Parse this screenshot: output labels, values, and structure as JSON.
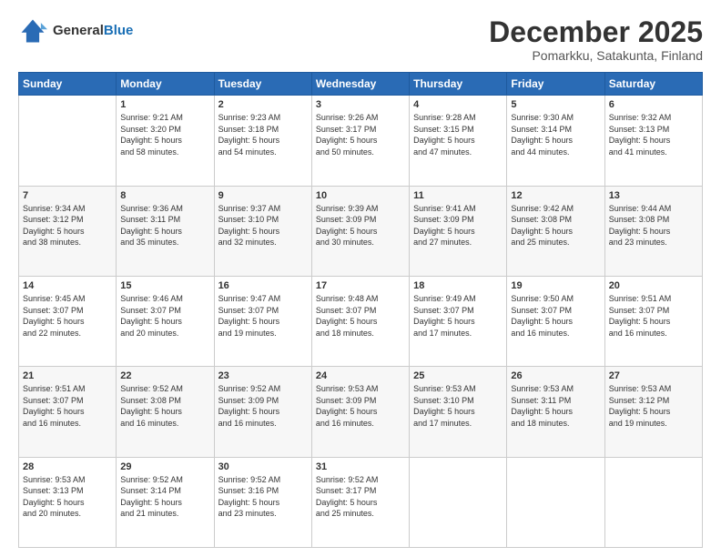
{
  "header": {
    "logo_line1": "General",
    "logo_line2": "Blue",
    "month": "December 2025",
    "location": "Pomarkku, Satakunta, Finland"
  },
  "days_of_week": [
    "Sunday",
    "Monday",
    "Tuesday",
    "Wednesday",
    "Thursday",
    "Friday",
    "Saturday"
  ],
  "weeks": [
    [
      {
        "day": "",
        "info": ""
      },
      {
        "day": "1",
        "info": "Sunrise: 9:21 AM\nSunset: 3:20 PM\nDaylight: 5 hours\nand 58 minutes."
      },
      {
        "day": "2",
        "info": "Sunrise: 9:23 AM\nSunset: 3:18 PM\nDaylight: 5 hours\nand 54 minutes."
      },
      {
        "day": "3",
        "info": "Sunrise: 9:26 AM\nSunset: 3:17 PM\nDaylight: 5 hours\nand 50 minutes."
      },
      {
        "day": "4",
        "info": "Sunrise: 9:28 AM\nSunset: 3:15 PM\nDaylight: 5 hours\nand 47 minutes."
      },
      {
        "day": "5",
        "info": "Sunrise: 9:30 AM\nSunset: 3:14 PM\nDaylight: 5 hours\nand 44 minutes."
      },
      {
        "day": "6",
        "info": "Sunrise: 9:32 AM\nSunset: 3:13 PM\nDaylight: 5 hours\nand 41 minutes."
      }
    ],
    [
      {
        "day": "7",
        "info": "Sunrise: 9:34 AM\nSunset: 3:12 PM\nDaylight: 5 hours\nand 38 minutes."
      },
      {
        "day": "8",
        "info": "Sunrise: 9:36 AM\nSunset: 3:11 PM\nDaylight: 5 hours\nand 35 minutes."
      },
      {
        "day": "9",
        "info": "Sunrise: 9:37 AM\nSunset: 3:10 PM\nDaylight: 5 hours\nand 32 minutes."
      },
      {
        "day": "10",
        "info": "Sunrise: 9:39 AM\nSunset: 3:09 PM\nDaylight: 5 hours\nand 30 minutes."
      },
      {
        "day": "11",
        "info": "Sunrise: 9:41 AM\nSunset: 3:09 PM\nDaylight: 5 hours\nand 27 minutes."
      },
      {
        "day": "12",
        "info": "Sunrise: 9:42 AM\nSunset: 3:08 PM\nDaylight: 5 hours\nand 25 minutes."
      },
      {
        "day": "13",
        "info": "Sunrise: 9:44 AM\nSunset: 3:08 PM\nDaylight: 5 hours\nand 23 minutes."
      }
    ],
    [
      {
        "day": "14",
        "info": "Sunrise: 9:45 AM\nSunset: 3:07 PM\nDaylight: 5 hours\nand 22 minutes."
      },
      {
        "day": "15",
        "info": "Sunrise: 9:46 AM\nSunset: 3:07 PM\nDaylight: 5 hours\nand 20 minutes."
      },
      {
        "day": "16",
        "info": "Sunrise: 9:47 AM\nSunset: 3:07 PM\nDaylight: 5 hours\nand 19 minutes."
      },
      {
        "day": "17",
        "info": "Sunrise: 9:48 AM\nSunset: 3:07 PM\nDaylight: 5 hours\nand 18 minutes."
      },
      {
        "day": "18",
        "info": "Sunrise: 9:49 AM\nSunset: 3:07 PM\nDaylight: 5 hours\nand 17 minutes."
      },
      {
        "day": "19",
        "info": "Sunrise: 9:50 AM\nSunset: 3:07 PM\nDaylight: 5 hours\nand 16 minutes."
      },
      {
        "day": "20",
        "info": "Sunrise: 9:51 AM\nSunset: 3:07 PM\nDaylight: 5 hours\nand 16 minutes."
      }
    ],
    [
      {
        "day": "21",
        "info": "Sunrise: 9:51 AM\nSunset: 3:07 PM\nDaylight: 5 hours\nand 16 minutes."
      },
      {
        "day": "22",
        "info": "Sunrise: 9:52 AM\nSunset: 3:08 PM\nDaylight: 5 hours\nand 16 minutes."
      },
      {
        "day": "23",
        "info": "Sunrise: 9:52 AM\nSunset: 3:09 PM\nDaylight: 5 hours\nand 16 minutes."
      },
      {
        "day": "24",
        "info": "Sunrise: 9:53 AM\nSunset: 3:09 PM\nDaylight: 5 hours\nand 16 minutes."
      },
      {
        "day": "25",
        "info": "Sunrise: 9:53 AM\nSunset: 3:10 PM\nDaylight: 5 hours\nand 17 minutes."
      },
      {
        "day": "26",
        "info": "Sunrise: 9:53 AM\nSunset: 3:11 PM\nDaylight: 5 hours\nand 18 minutes."
      },
      {
        "day": "27",
        "info": "Sunrise: 9:53 AM\nSunset: 3:12 PM\nDaylight: 5 hours\nand 19 minutes."
      }
    ],
    [
      {
        "day": "28",
        "info": "Sunrise: 9:53 AM\nSunset: 3:13 PM\nDaylight: 5 hours\nand 20 minutes."
      },
      {
        "day": "29",
        "info": "Sunrise: 9:52 AM\nSunset: 3:14 PM\nDaylight: 5 hours\nand 21 minutes."
      },
      {
        "day": "30",
        "info": "Sunrise: 9:52 AM\nSunset: 3:16 PM\nDaylight: 5 hours\nand 23 minutes."
      },
      {
        "day": "31",
        "info": "Sunrise: 9:52 AM\nSunset: 3:17 PM\nDaylight: 5 hours\nand 25 minutes."
      },
      {
        "day": "",
        "info": ""
      },
      {
        "day": "",
        "info": ""
      },
      {
        "day": "",
        "info": ""
      }
    ]
  ]
}
